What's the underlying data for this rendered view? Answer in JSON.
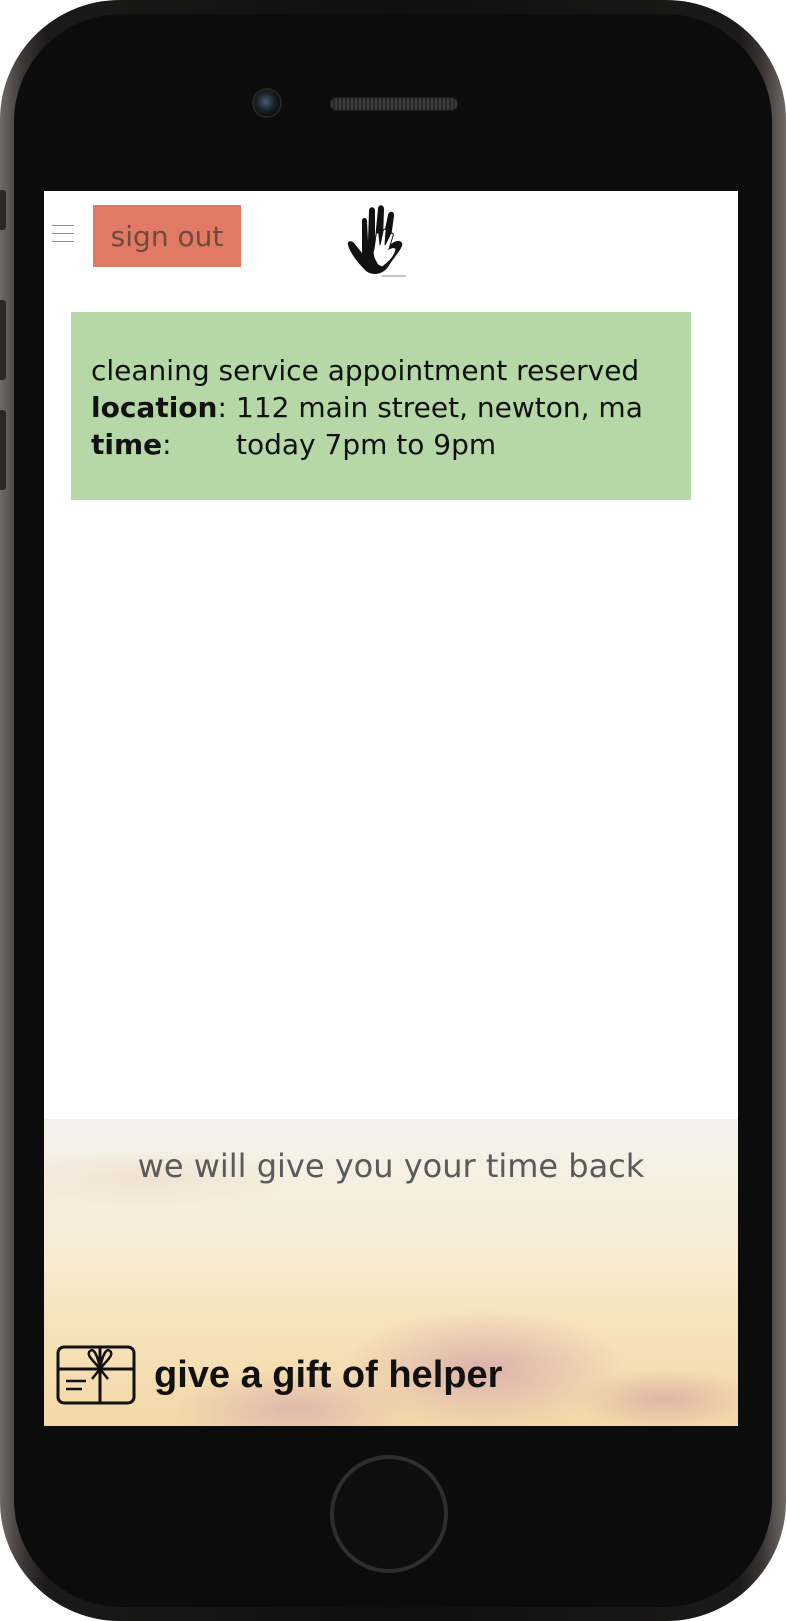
{
  "header": {
    "menu_icon": "hamburger-menu-icon",
    "signout_label": "sign out",
    "logo_icon": "helping-hands-logo"
  },
  "appointment": {
    "message": "cleaning service appointment reserved",
    "location_label": "location",
    "location_value": "112 main street, newton, ma",
    "time_label": "time",
    "time_value": "today 7pm to 9pm",
    "background_color": "#b5d8a6"
  },
  "banner": {
    "tagline": "we will give you your time back",
    "gift_icon": "gift-card-icon",
    "gift_label": "give a gift of helper"
  },
  "colors": {
    "signout_bg": "#e07a64",
    "signout_text": "#6e4a40"
  }
}
